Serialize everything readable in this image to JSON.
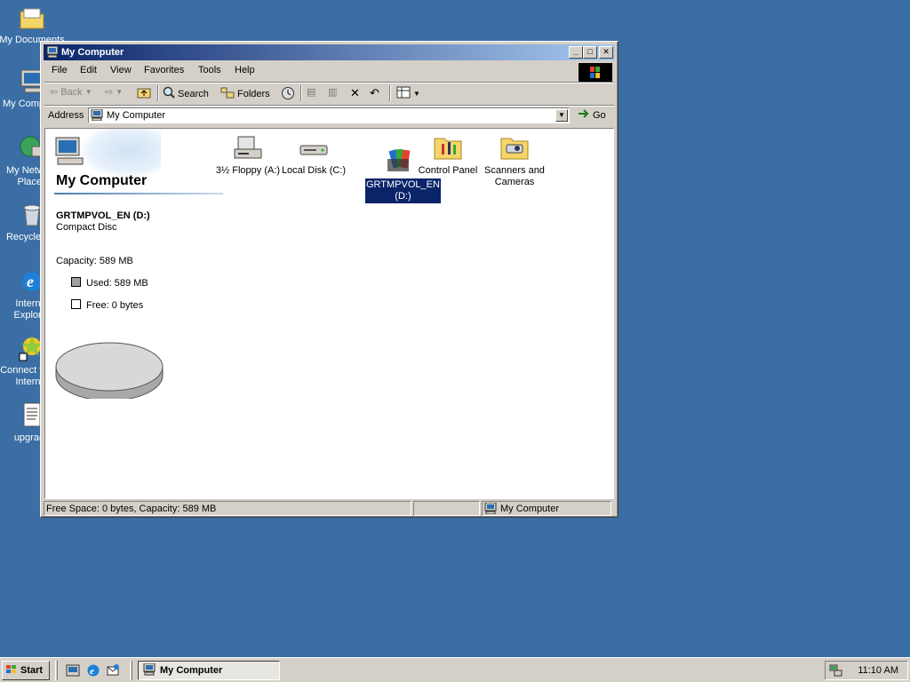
{
  "desktop": {
    "icons": [
      {
        "label": "My Documents"
      },
      {
        "label": "My Computer"
      },
      {
        "label": "My Network Places"
      },
      {
        "label": "Recycle Bin"
      },
      {
        "label": "Internet Explorer"
      },
      {
        "label": "Connect to the Internet"
      },
      {
        "label": "upgrade"
      }
    ]
  },
  "window": {
    "title": "My Computer",
    "menu": [
      "File",
      "Edit",
      "View",
      "Favorites",
      "Tools",
      "Help"
    ],
    "toolbar": {
      "back": "Back",
      "search": "Search",
      "folders": "Folders"
    },
    "address": {
      "label": "Address",
      "value": "My Computer",
      "go": "Go"
    },
    "left_panel": {
      "title": "My Computer",
      "drive_name": "GRTMPVOL_EN (D:)",
      "drive_type": "Compact Disc",
      "capacity": "Capacity: 589 MB",
      "used": "Used: 589 MB",
      "free": "Free: 0 bytes"
    },
    "items": [
      {
        "label": "3½ Floppy (A:)",
        "icon": "floppy-drive-icon"
      },
      {
        "label": "Local Disk (C:)",
        "icon": "hard-disk-icon"
      },
      {
        "label": "GRTMPVOL_EN (D:)",
        "icon": "cd-drive-icon",
        "selected": true
      },
      {
        "label": "Control Panel",
        "icon": "control-panel-icon"
      },
      {
        "label": "Scanners and Cameras",
        "icon": "scanners-cameras-icon"
      }
    ],
    "status": {
      "main": "Free Space: 0 bytes, Capacity: 589 MB",
      "zone": "My Computer"
    }
  },
  "taskbar": {
    "start": "Start",
    "task": "My Computer",
    "clock": "11:10 AM"
  },
  "colors": {
    "desktop": "#3a6ea5",
    "titlebar_start": "#0a246a",
    "titlebar_end": "#a6caf0",
    "selection": "#0a246a"
  }
}
